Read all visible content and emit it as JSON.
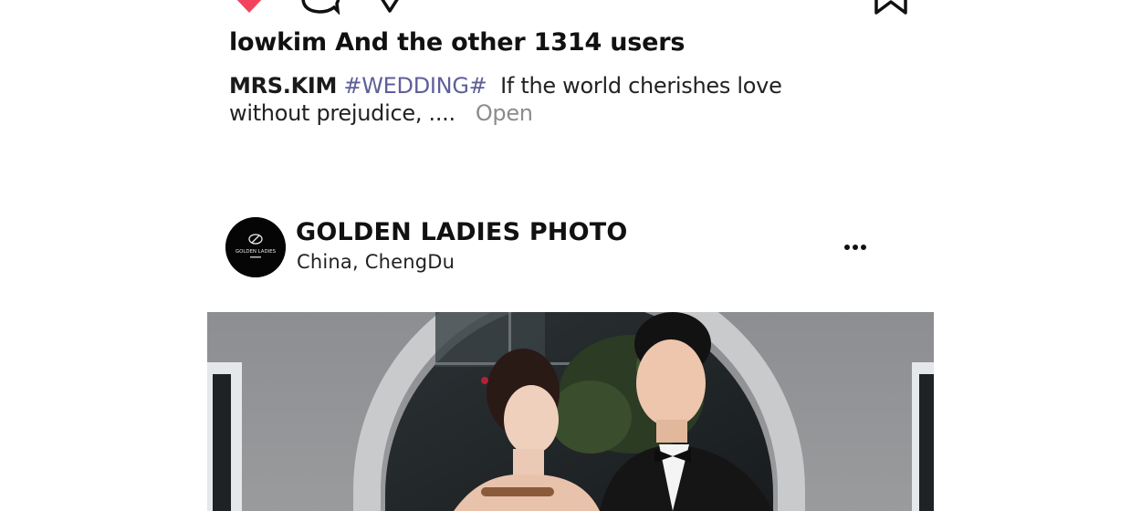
{
  "post_previous": {
    "likes_text": "lowkim And the other 1314 users",
    "caption": {
      "author": "MRS.KIM",
      "hashtag": "#WEDDING#",
      "text": "If the world cherishes love without prejudice, ....",
      "open_label": "Open"
    }
  },
  "post": {
    "account_name": "GOLDEN LADIES PHOTO",
    "location_country": "China,",
    "location_city": "ChengDu",
    "avatar_logo_text": "GOLDEN LADIES"
  },
  "icons": {
    "like": "heart-icon",
    "comment": "comment-icon",
    "share": "share-icon",
    "bookmark": "bookmark-icon",
    "more": "more-options-icon"
  },
  "colors": {
    "like_red": "#f2435e",
    "hashtag": "#5f5f9a",
    "open_link": "#8c8c8c",
    "wall_gray": "#8f9194"
  }
}
